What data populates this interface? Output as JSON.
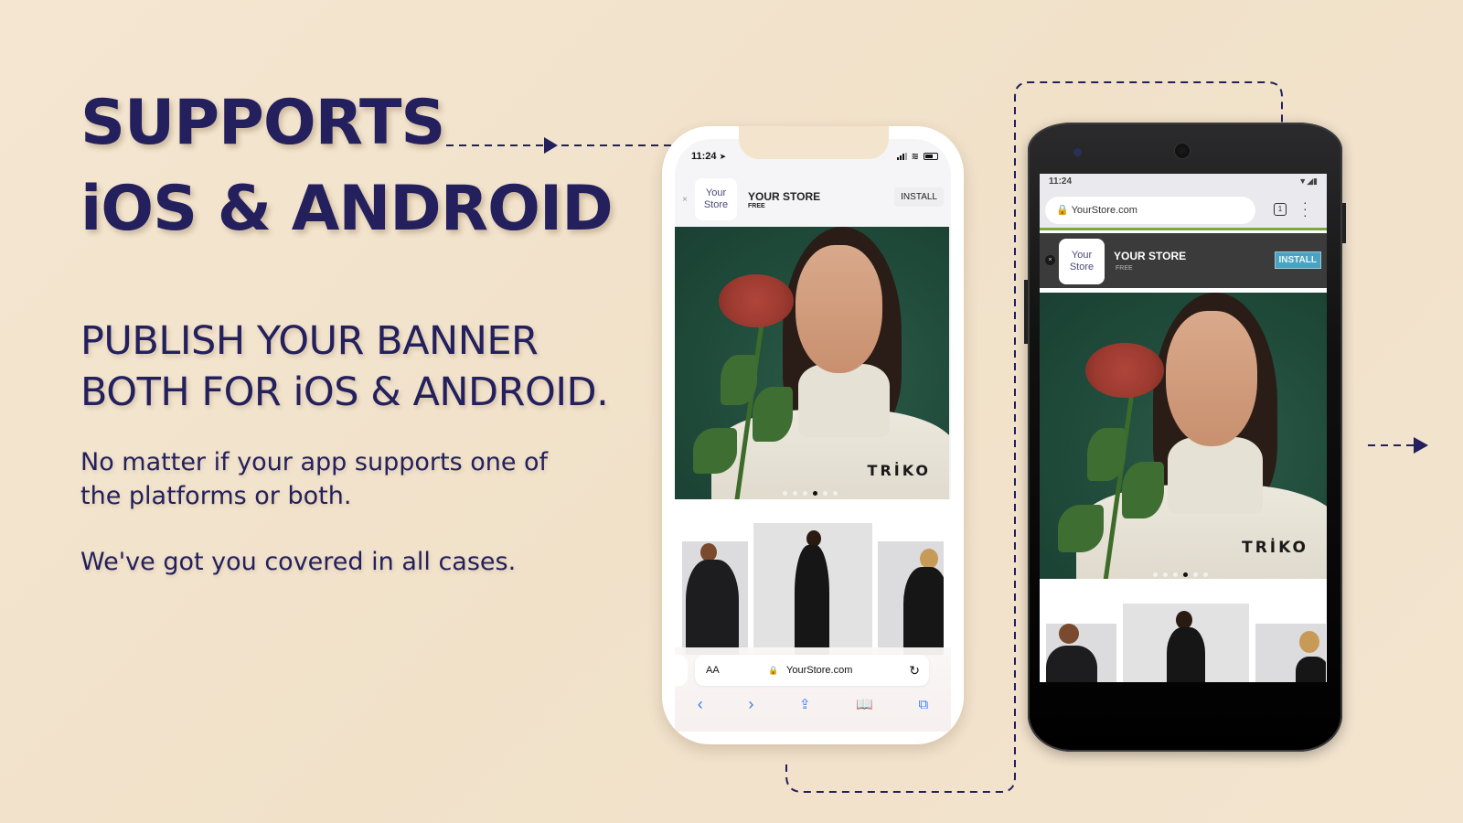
{
  "headline": {
    "line1": "SUPPORTS",
    "line2": "iOS & ANDROID"
  },
  "subhead": {
    "line1": "PUBLISH YOUR BANNER",
    "line2": "BOTH FOR iOS & ANDROID."
  },
  "body": {
    "line1": "No matter if your app supports one of",
    "line2": "the platforms or both.",
    "line3": "We've got you covered in all cases."
  },
  "colors": {
    "background": "#f3e4cd",
    "text": "#23205d",
    "android_install": "#4aa3c3",
    "android_banner": "#3b3b3b",
    "safari_accent": "#3a7bf0",
    "hero_bg": "#1f4a3a"
  },
  "ios": {
    "status_time": "11:24",
    "status_icons": [
      "location-arrow-icon",
      "signal-icon",
      "wifi-icon",
      "battery-icon"
    ],
    "banner": {
      "close": "×",
      "app_icon_line1": "Your",
      "app_icon_line2": "Store",
      "app_name": "YOUR STORE",
      "app_price": "FREE",
      "install_label": "INSTALL"
    },
    "hero_brand": "TRİKO",
    "carousel": {
      "count": 6,
      "active_index": 3
    },
    "safari": {
      "text_size_label": "AA",
      "url": "YourStore.com",
      "nav_icons": [
        "back-icon",
        "forward-icon",
        "share-icon",
        "bookmarks-icon",
        "tabs-icon"
      ]
    }
  },
  "android": {
    "status_time": "11:24",
    "url": "YourStore.com",
    "tab_count": "1",
    "banner": {
      "close": "×",
      "app_icon_line1": "Your",
      "app_icon_line2": "Store",
      "app_name": "YOUR STORE",
      "app_price": "FREE",
      "install_label": "INSTALL"
    },
    "hero_brand": "TRİKO",
    "carousel": {
      "count": 6,
      "active_index": 3
    }
  }
}
